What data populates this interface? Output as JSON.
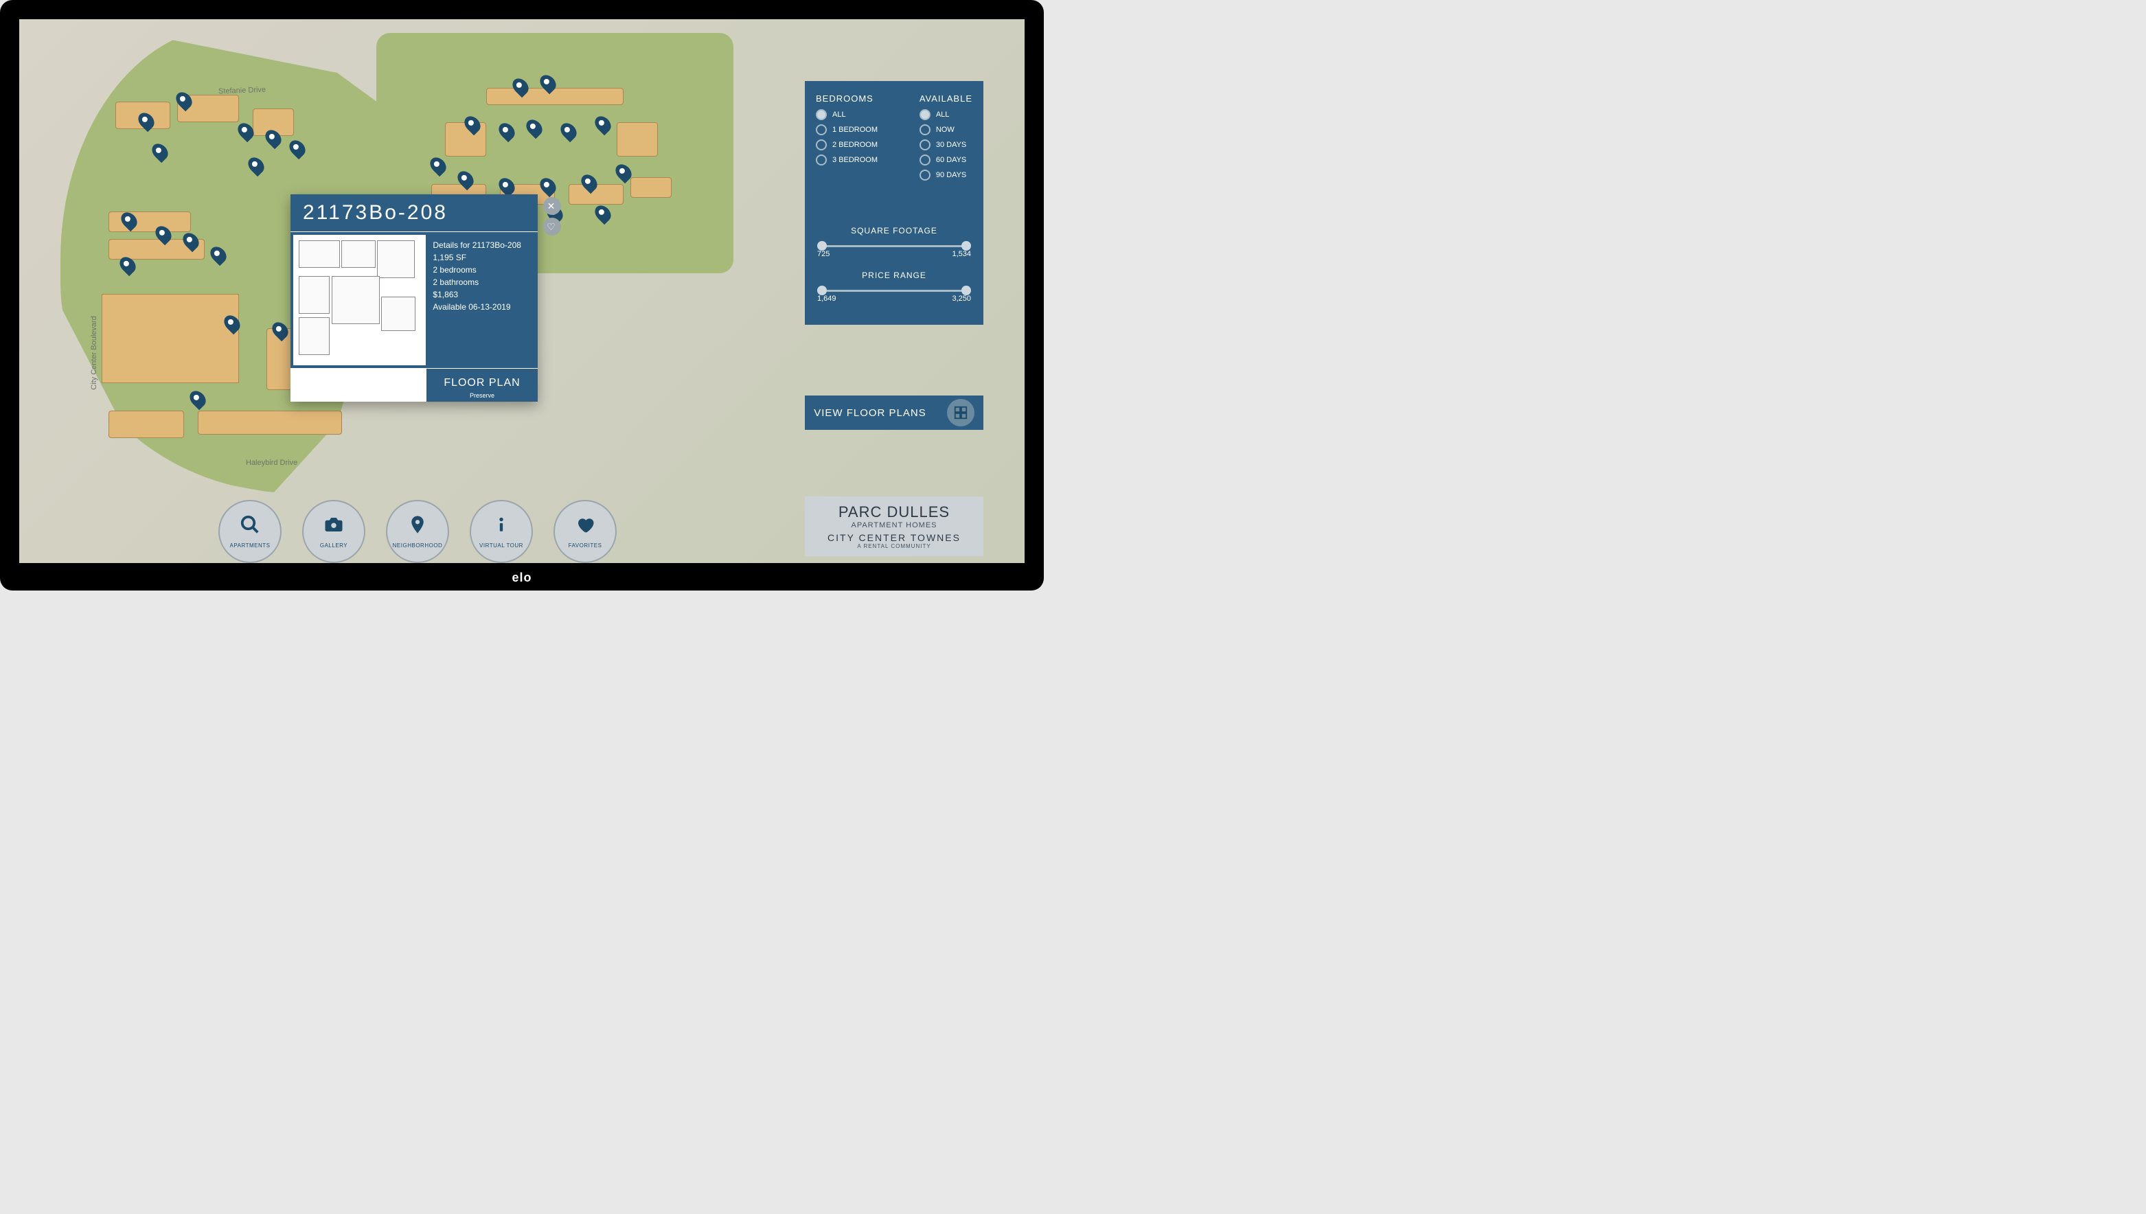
{
  "device": "elo",
  "map": {
    "streets": [
      "Stefanie Drive",
      "City Center Boulevard",
      "Haleybird Drive"
    ]
  },
  "unit_popup": {
    "unit_id": "21173Bo-208",
    "details_title": "Details for 21173Bo-208",
    "sqft": "1,195 SF",
    "bedrooms": "2 bedrooms",
    "bathrooms": "2 bathrooms",
    "price": "$1,863",
    "available": "Available 06-13-2019",
    "floor_plan_label": "FLOOR PLAN",
    "floor_plan_sub": "Preserve"
  },
  "filters": {
    "bedrooms": {
      "title": "BEDROOMS",
      "options": [
        "ALL",
        "1 BEDROOM",
        "2 BEDROOM",
        "3 BEDROOM"
      ],
      "selected": "ALL"
    },
    "available": {
      "title": "AVAILABLE",
      "options": [
        "ALL",
        "NOW",
        "30 DAYS",
        "60 DAYS",
        "90 DAYS"
      ],
      "selected": "ALL"
    },
    "square_footage": {
      "title": "SQUARE FOOTAGE",
      "min": "725",
      "max": "1,534"
    },
    "price_range": {
      "title": "PRICE RANGE",
      "min": "1,649",
      "max": "3,250"
    }
  },
  "view_floor_plans_label": "VIEW FLOOR PLANS",
  "nav": {
    "apartments": "APARTMENTS",
    "gallery": "GALLERY",
    "neighborhood": "NEIGHBORHOOD",
    "virtual_tour": "VIRTUAL TOUR",
    "favorites": "FAVORITES"
  },
  "brand": {
    "line1": "PARC DULLES",
    "line2": "APARTMENT HOMES",
    "line3": "CITY CENTER TOWNES",
    "line4": "A RENTAL COMMUNITY"
  }
}
